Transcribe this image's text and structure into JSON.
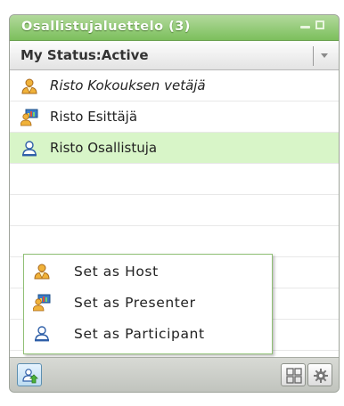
{
  "pod": {
    "title": "Osallistujaluettelo (3)"
  },
  "status": {
    "label": "My Status:Active"
  },
  "attendees": [
    {
      "name": "Risto Kokouksen vetäjä",
      "role_icon": "host-icon",
      "italic": true
    },
    {
      "name": "Risto Esittäjä",
      "role_icon": "presenter-icon",
      "italic": false
    },
    {
      "name": "Risto Osallistuja",
      "role_icon": "participant-icon",
      "italic": false,
      "selected": true
    }
  ],
  "context_menu": {
    "items": [
      {
        "label": "Set as Host",
        "icon": "host-icon"
      },
      {
        "label": "Set as Presenter",
        "icon": "presenter-icon"
      },
      {
        "label": "Set as Participant",
        "icon": "participant-icon"
      }
    ]
  },
  "toolbar": {
    "left_button_icon": "change-role-icon",
    "right_buttons": [
      "display-mode-icon",
      "gear-icon"
    ]
  },
  "colors": {
    "title_bar": "#7cbf5c",
    "selected_row": "#d8f5c8",
    "menu_border": "#8fbf74"
  }
}
